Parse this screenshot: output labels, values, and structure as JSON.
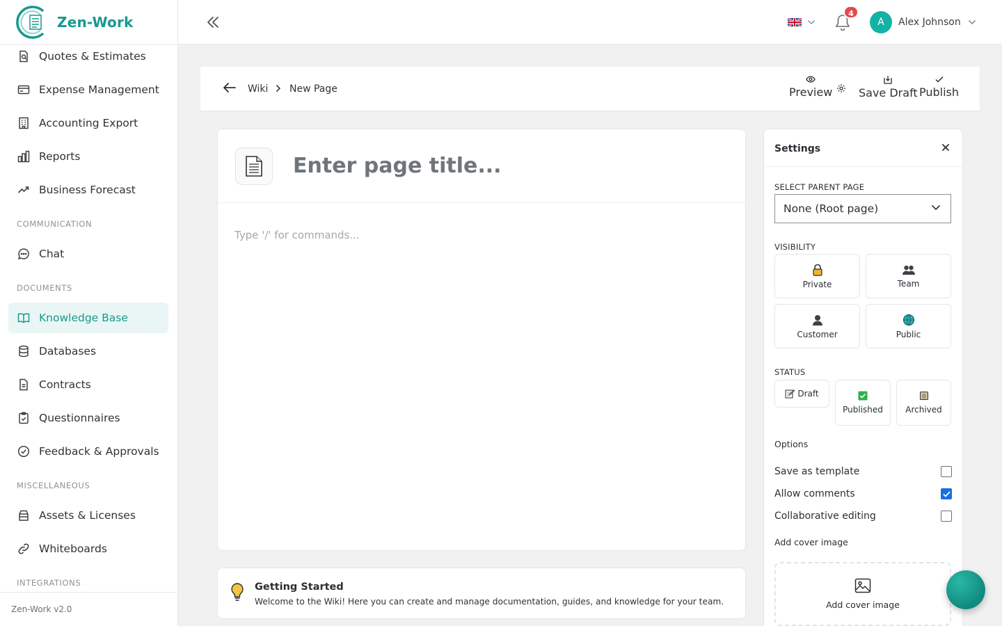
{
  "app": {
    "name": "Zen-Work",
    "version": "Zen-Work v2.0"
  },
  "sidebar": {
    "items": [
      {
        "label": "Quotes & Estimates",
        "icon": "quote-icon"
      },
      {
        "label": "Expense Management",
        "icon": "credit-card-icon"
      },
      {
        "label": "Accounting Export",
        "icon": "building-icon"
      },
      {
        "label": "Reports",
        "icon": "bar-chart-icon"
      },
      {
        "label": "Business Forecast",
        "icon": "trend-up-icon"
      },
      {
        "label": "Chat",
        "icon": "chat-bubble-icon"
      },
      {
        "label": "Knowledge Base",
        "icon": "book-open-icon",
        "active": true
      },
      {
        "label": "Databases",
        "icon": "database-icon"
      },
      {
        "label": "Contracts",
        "icon": "document-icon"
      },
      {
        "label": "Questionnaires",
        "icon": "clipboard-check-icon"
      },
      {
        "label": "Feedback & Approvals",
        "icon": "check-circle-icon"
      },
      {
        "label": "Assets & Licenses",
        "icon": "archive-box-icon"
      },
      {
        "label": "Whiteboards",
        "icon": "link-icon"
      }
    ],
    "sections": [
      "COMMUNICATION",
      "DOCUMENTS",
      "MISCELLANEOUS",
      "INTEGRATIONS"
    ]
  },
  "topbar": {
    "language": "flag-uk-icon",
    "notification_count": "4",
    "user": {
      "initial": "A",
      "name": "Alex Johnson"
    }
  },
  "breadcrumb": {
    "parent": "Wiki",
    "current": "New Page"
  },
  "actions": {
    "preview": "Preview",
    "save_draft": "Save Draft",
    "publish": "Publish"
  },
  "editor": {
    "title_placeholder": "Enter page title...",
    "body_placeholder": "Type '/' for commands..."
  },
  "tip": {
    "title": "Getting Started",
    "text": "Welcome to the Wiki! Here you can create and manage documentation, guides, and knowledge for your team."
  },
  "settings": {
    "title": "Settings",
    "parent_label": "SELECT PARENT PAGE",
    "parent_value": "None (Root page)",
    "visibility_label": "VISIBILITY",
    "visibility": [
      "Private",
      "Team",
      "Customer",
      "Public"
    ],
    "status_label": "STATUS",
    "status": [
      "Draft",
      "Published",
      "Archived"
    ],
    "options_label": "Options",
    "options": [
      {
        "label": "Save as template",
        "checked": false
      },
      {
        "label": "Allow comments",
        "checked": true
      },
      {
        "label": "Collaborative editing",
        "checked": false
      }
    ],
    "cover_label": "Add cover image",
    "cover_button": "Add cover image"
  },
  "colors": {
    "brand": "#17998f",
    "active_bg": "#eaf6f5",
    "badge": "#e5484d",
    "checkbox": "#1a6fe0",
    "avatar": "#13b2a7"
  }
}
